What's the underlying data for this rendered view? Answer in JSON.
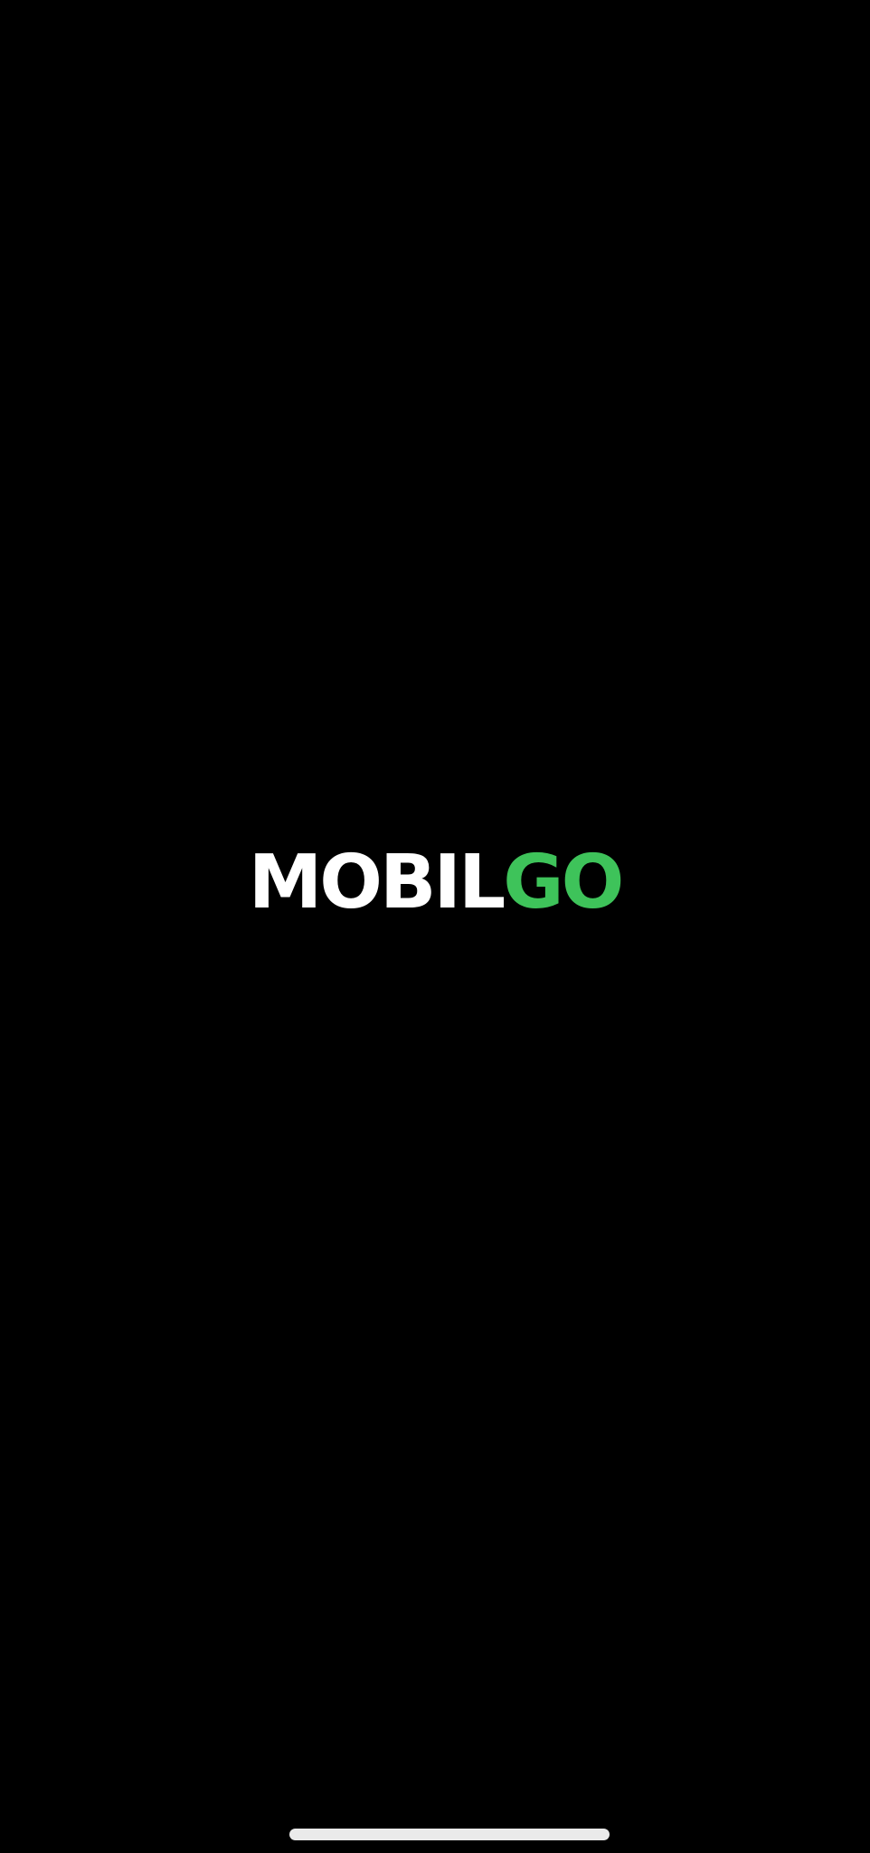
{
  "splash": {
    "logo_text_white": "MOBIL",
    "logo_text_green": "GO"
  },
  "colors": {
    "background": "#000000",
    "logo_white": "#ffffff",
    "logo_green": "#3ec35a",
    "home_indicator": "#eaeaea"
  }
}
